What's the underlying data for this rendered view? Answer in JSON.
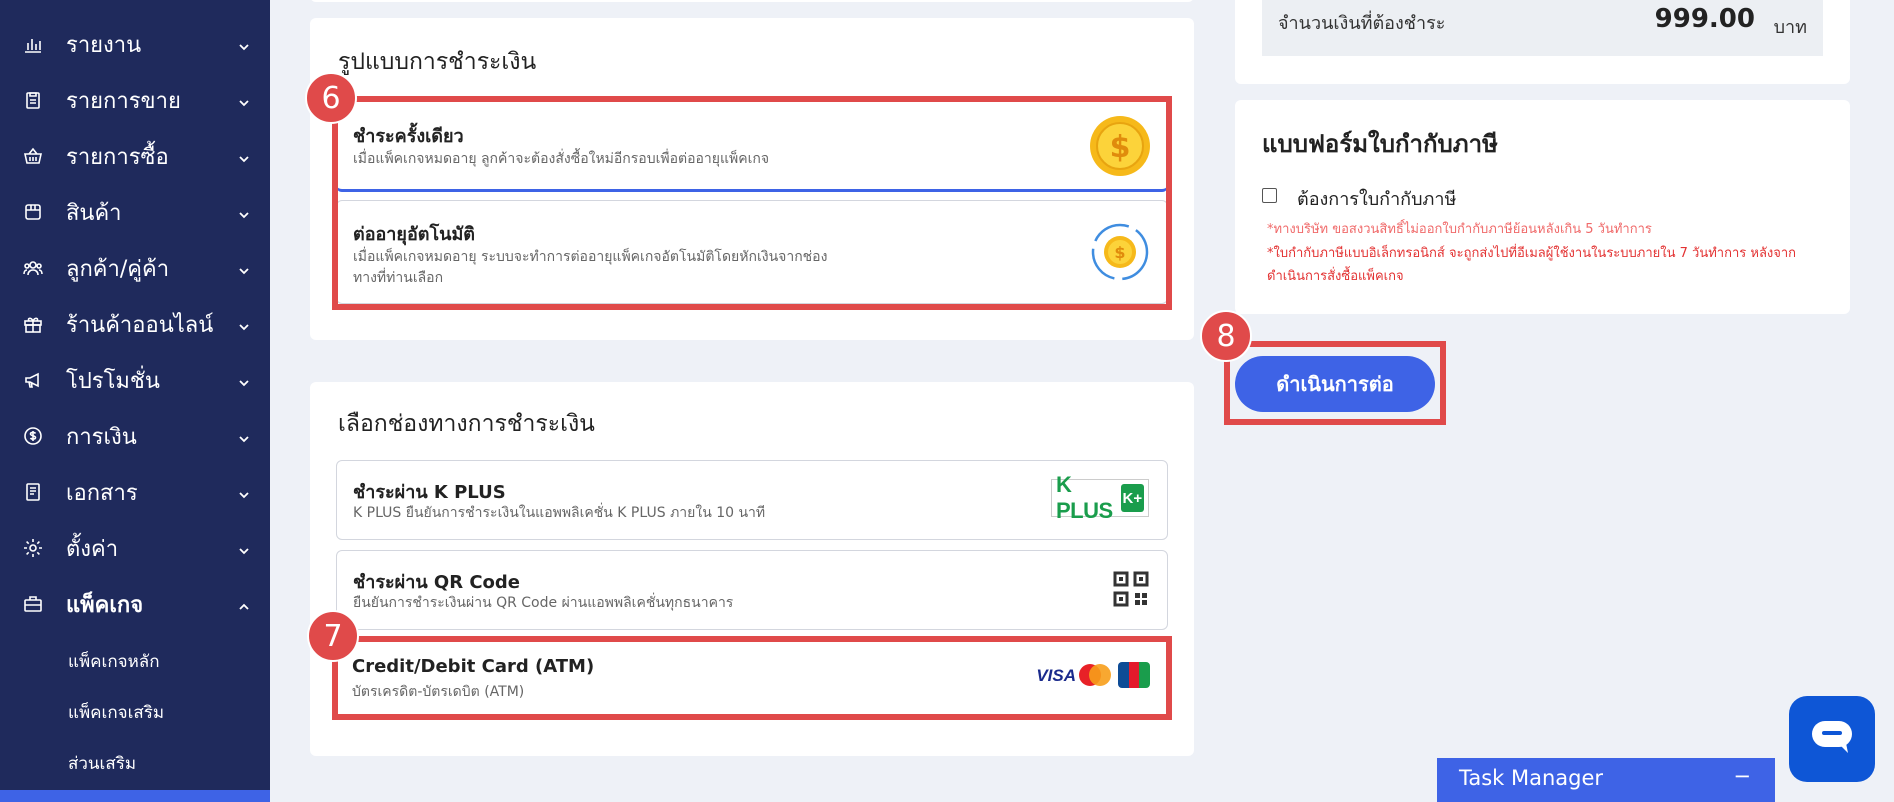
{
  "sidebar": {
    "items": [
      {
        "label": "รายงาน",
        "icon": "bar-chart-icon"
      },
      {
        "label": "รายการขาย",
        "icon": "clipboard-icon"
      },
      {
        "label": "รายการซื้อ",
        "icon": "basket-icon"
      },
      {
        "label": "สินค้า",
        "icon": "box-icon"
      },
      {
        "label": "ลูกค้า/คู่ค้า",
        "icon": "users-icon"
      },
      {
        "label": "ร้านค้าออนไลน์",
        "icon": "gift-icon"
      },
      {
        "label": "โปรโมชั่น",
        "icon": "megaphone-icon"
      },
      {
        "label": "การเงิน",
        "icon": "coin-icon"
      },
      {
        "label": "เอกสาร",
        "icon": "document-icon"
      },
      {
        "label": "ตั้งค่า",
        "icon": "gear-icon"
      },
      {
        "label": "แพ็คเกจ",
        "icon": "briefcase-icon"
      }
    ],
    "sub_items": [
      "แพ็คเกจหลัก",
      "แพ็คเกจเสริม",
      "ส่วนเสริม"
    ]
  },
  "payment_type": {
    "title": "รูปแบบการชำระเงิน",
    "step": "6",
    "options": [
      {
        "title": "ชำระครั้งเดียว",
        "desc": "เมื่อแพ็คเกจหมดอายุ ลูกค้าจะต้องสั่งซื้อใหม่อีกรอบเพื่อต่ออายุแพ็คเกจ",
        "icon": "dollar-coin-icon"
      },
      {
        "title": "ต่ออายุอัตโนมัติ",
        "desc1": "เมื่อแพ็คเกจหมดอายุ ระบบจะทำการต่ออายุแพ็คเกจอัตโนมัติโดยหักเงินจากช่อง",
        "desc2": "ทางที่ท่านเลือก",
        "icon": "auto-renew-coin-icon"
      }
    ]
  },
  "payment_channel": {
    "title": "เลือกช่องทางการชำระเงิน",
    "step": "7",
    "options": [
      {
        "title": "ชำระผ่าน K PLUS",
        "desc": "K PLUS ยืนยันการชำระเงินในแอพพลิเคชั่น K PLUS ภายใน 10 นาที",
        "logo": "K PLUS",
        "logo_mark": "K+"
      },
      {
        "title": "ชำระผ่าน QR Code",
        "desc": "ยืนยันการชำระเงินผ่าน QR Code ผ่านแอพพลิเคชั่นทุกธนาคาร",
        "icon": "qr-code-icon"
      },
      {
        "title": "Credit/Debit Card (ATM)",
        "desc": "บัตรเครดิต-บัตรเดบิต (ATM)",
        "logos": [
          "VISA",
          "MasterCard",
          "JCB"
        ]
      }
    ]
  },
  "summary": {
    "label": "จำนวนเงินที่ต้องชำระ",
    "amount": "999.00",
    "currency": "บาท"
  },
  "tax_form": {
    "title": "แบบฟอร์มใบกำกับภาษี",
    "checkbox_label": "ต้องการใบกำกับภาษี",
    "checked": false,
    "note1": "*ทางบริษัท ขอสงวนสิทธิ์ไม่ออกใบกำกับภาษีย้อนหลังเกิน 5 วันทำการ",
    "note2a": "*ใบกำกับภาษีแบบอิเล็กทรอนิกส์ จะถูกส่งไปที่อีเมลผู้ใช้งานในระบบภายใน 7 วันทำการ หลังจาก",
    "note2b": "ดำเนินการสั่งซื้อแพ็คเกจ"
  },
  "continue_button": {
    "label": "ดำเนินการต่อ",
    "step": "8"
  },
  "task_manager": {
    "label": "Task Manager",
    "toggle": "−"
  },
  "colors": {
    "sidebar_bg": "#1f2a5c",
    "accent": "#3e63e6",
    "highlight_red": "#e04a4a",
    "note_red": "#e33232",
    "note_pink": "#f06a6a",
    "kplus_green": "#1a9d4c",
    "chat_blue": "#0e56d6"
  }
}
